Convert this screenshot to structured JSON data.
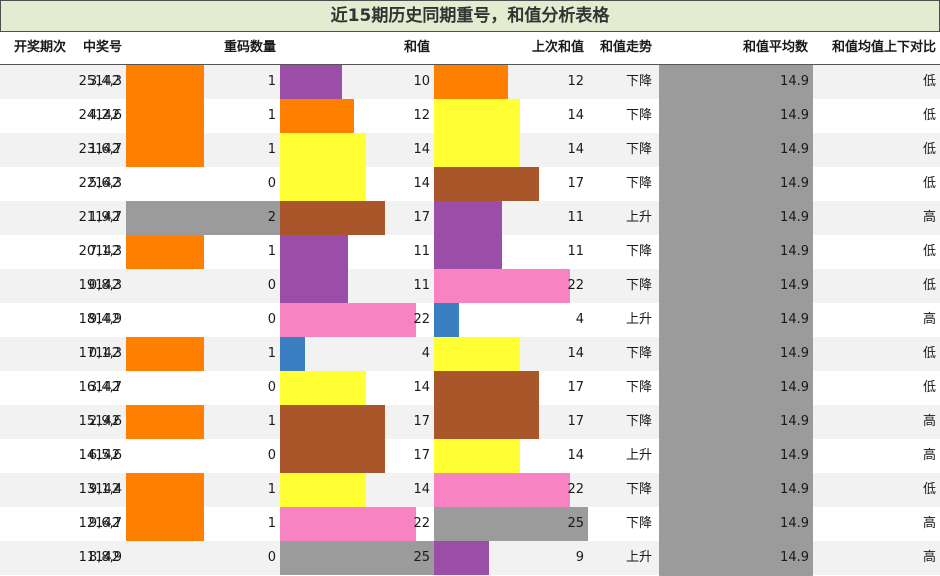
{
  "title": "近15期历史同期重号，和值分析表格",
  "columns": [
    "开奖期次",
    "中奖号",
    "重码数量",
    "和值",
    "上次和值",
    "和值走势",
    "和值平均数",
    "和值均值上下对比"
  ],
  "colors": {
    "repeat_1": "#ff8000",
    "repeat_2": "#9b9b9b",
    "sum_4": "#3a7fc1",
    "sum_9": "#9b4ea8",
    "sum_10": "#9b4ea8",
    "sum_11": "#9b4ea8",
    "sum_12": "#ff8000",
    "sum_14": "#ffff33",
    "sum_17": "#a9572a",
    "sum_22": "#f783c2",
    "sum_25": "#9b9b9b",
    "avg": "#9b9b9b"
  },
  "rows": [
    {
      "period": "25142",
      "numbers": "3,4,3",
      "repeat": 1,
      "sum": 10,
      "prev_sum": 12,
      "trend": "下降",
      "avg": "14.9",
      "compare": "低"
    },
    {
      "period": "24142",
      "numbers": "4,2,6",
      "repeat": 1,
      "sum": 12,
      "prev_sum": 14,
      "trend": "下降",
      "avg": "14.9",
      "compare": "低"
    },
    {
      "period": "23142",
      "numbers": "1,6,7",
      "repeat": 1,
      "sum": 14,
      "prev_sum": 14,
      "trend": "下降",
      "avg": "14.9",
      "compare": "低"
    },
    {
      "period": "22142",
      "numbers": "5,6,3",
      "repeat": 0,
      "sum": 14,
      "prev_sum": 17,
      "trend": "下降",
      "avg": "14.9",
      "compare": "低"
    },
    {
      "period": "21142",
      "numbers": "1,9,7",
      "repeat": 2,
      "sum": 17,
      "prev_sum": 11,
      "trend": "上升",
      "avg": "14.9",
      "compare": "高"
    },
    {
      "period": "20142",
      "numbers": "7,1,3",
      "repeat": 1,
      "sum": 11,
      "prev_sum": 11,
      "trend": "下降",
      "avg": "14.9",
      "compare": "低"
    },
    {
      "period": "19142",
      "numbers": "0,8,3",
      "repeat": 0,
      "sum": 11,
      "prev_sum": 22,
      "trend": "下降",
      "avg": "14.9",
      "compare": "低"
    },
    {
      "period": "18142",
      "numbers": "9,4,9",
      "repeat": 0,
      "sum": 22,
      "prev_sum": 4,
      "trend": "上升",
      "avg": "14.9",
      "compare": "高"
    },
    {
      "period": "17142",
      "numbers": "0,1,3",
      "repeat": 1,
      "sum": 4,
      "prev_sum": 14,
      "trend": "下降",
      "avg": "14.9",
      "compare": "低"
    },
    {
      "period": "16142",
      "numbers": "3,4,7",
      "repeat": 0,
      "sum": 14,
      "prev_sum": 17,
      "trend": "下降",
      "avg": "14.9",
      "compare": "低"
    },
    {
      "period": "15142",
      "numbers": "2,9,6",
      "repeat": 1,
      "sum": 17,
      "prev_sum": 17,
      "trend": "下降",
      "avg": "14.9",
      "compare": "高"
    },
    {
      "period": "14142",
      "numbers": "6,5,6",
      "repeat": 0,
      "sum": 17,
      "prev_sum": 14,
      "trend": "上升",
      "avg": "14.9",
      "compare": "高"
    },
    {
      "period": "13142",
      "numbers": "9,1,4",
      "repeat": 1,
      "sum": 14,
      "prev_sum": 22,
      "trend": "下降",
      "avg": "14.9",
      "compare": "低"
    },
    {
      "period": "12142",
      "numbers": "9,6,7",
      "repeat": 1,
      "sum": 22,
      "prev_sum": 25,
      "trend": "下降",
      "avg": "14.9",
      "compare": "高"
    },
    {
      "period": "11142",
      "numbers": "8,8,9",
      "repeat": 0,
      "sum": 25,
      "prev_sum": 9,
      "trend": "上升",
      "avg": "14.9",
      "compare": "高"
    }
  ]
}
